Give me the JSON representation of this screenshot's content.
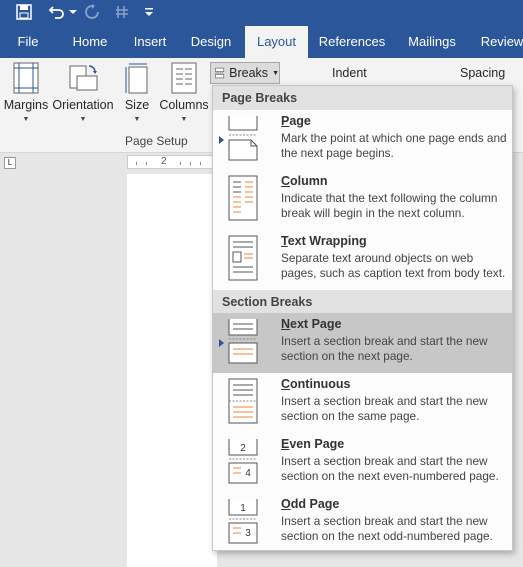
{
  "quick_access": {
    "save_icon": "save-icon",
    "undo_icon": "undo-icon",
    "redo_icon": "redo-icon",
    "customize_icon": "customize-icon"
  },
  "tabs": [
    {
      "label": "File"
    },
    {
      "label": "Home"
    },
    {
      "label": "Insert"
    },
    {
      "label": "Design"
    },
    {
      "label": "Layout"
    },
    {
      "label": "References"
    },
    {
      "label": "Mailings"
    },
    {
      "label": "Review"
    }
  ],
  "ribbon": {
    "margins": "Margins",
    "orientation": "Orientation",
    "size": "Size",
    "columns": "Columns",
    "breaks": "Breaks",
    "indent": "Indent",
    "spacing": "Spacing",
    "group_page_setup": "Page Setup"
  },
  "ruler": {
    "marker": "2",
    "corner": "L"
  },
  "breaks_menu": {
    "page_breaks_header": "Page Breaks",
    "section_breaks_header": "Section Breaks",
    "items": [
      {
        "title_u": "P",
        "title_rest": "age",
        "desc": "Mark the point at which one page ends and the next page begins."
      },
      {
        "title_u": "C",
        "title_rest": "olumn",
        "desc": "Indicate that the text following the column break will begin in the next column."
      },
      {
        "title_u": "T",
        "title_rest": "ext Wrapping",
        "desc": "Separate text around objects on web pages, such as caption text from body text."
      },
      {
        "title_u": "N",
        "title_rest": "ext Page",
        "desc": "Insert a section break and start the new section on the next page."
      },
      {
        "title_u": "C",
        "title_rest": "ontinuous",
        "desc": "Insert a section break and start the new section on the same page."
      },
      {
        "title_u": "E",
        "title_rest": "ven Page",
        "desc": "Insert a section break and start the new section on the next even-numbered page."
      },
      {
        "title_u": "O",
        "title_rest": "dd Page",
        "desc": "Insert a section break and start the new section on the next odd-numbered page."
      }
    ],
    "even_num": "2",
    "even_num2": "4",
    "odd_num": "1",
    "odd_num2": "3"
  },
  "colors": {
    "brand": "#2b579a",
    "selected_item": "#c7c7c7",
    "accent_orange": "#e8843c"
  }
}
